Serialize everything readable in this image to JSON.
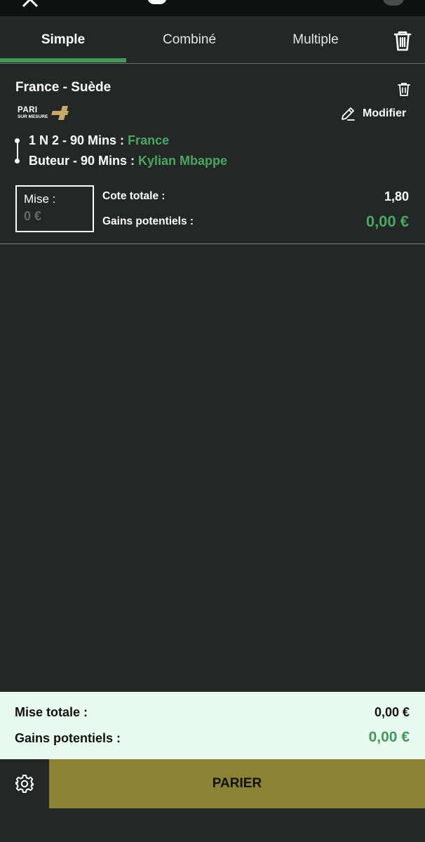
{
  "tabs": [
    {
      "label": "Simple",
      "active": true
    },
    {
      "label": "Combiné",
      "active": false
    },
    {
      "label": "Multiple",
      "active": false
    }
  ],
  "bet": {
    "match": "France - Suède",
    "logo": {
      "line1": "PARI",
      "line2": "SUR MESURE"
    },
    "modify_label": "Modifier",
    "selections": [
      {
        "market": "1 N 2 - 90 Mins :",
        "value": "France"
      },
      {
        "market": "Buteur - 90 Mins :",
        "value": "Kylian Mbappe"
      }
    ],
    "stake_label": "Mise :",
    "stake_placeholder": "0 €",
    "odds_label": "Cote totale :",
    "odds_value": "1,80",
    "gains_label": "Gains potentiels :",
    "gains_value": "0,00 €"
  },
  "summary": {
    "total_stake_label": "Mise totale  :",
    "total_stake_value": "0,00  €",
    "gains_label": "Gains potentiels :",
    "gains_value": "0,00 €"
  },
  "actions": {
    "bet_label": "PARIER"
  },
  "colors": {
    "accent": "#3f9a55",
    "bet_button": "#8b8334",
    "background": "#232725",
    "summary_bg": "#e9fbf1"
  },
  "icons": {
    "trash": "trash-icon",
    "edit": "pencil-icon",
    "settings": "gear-icon"
  }
}
